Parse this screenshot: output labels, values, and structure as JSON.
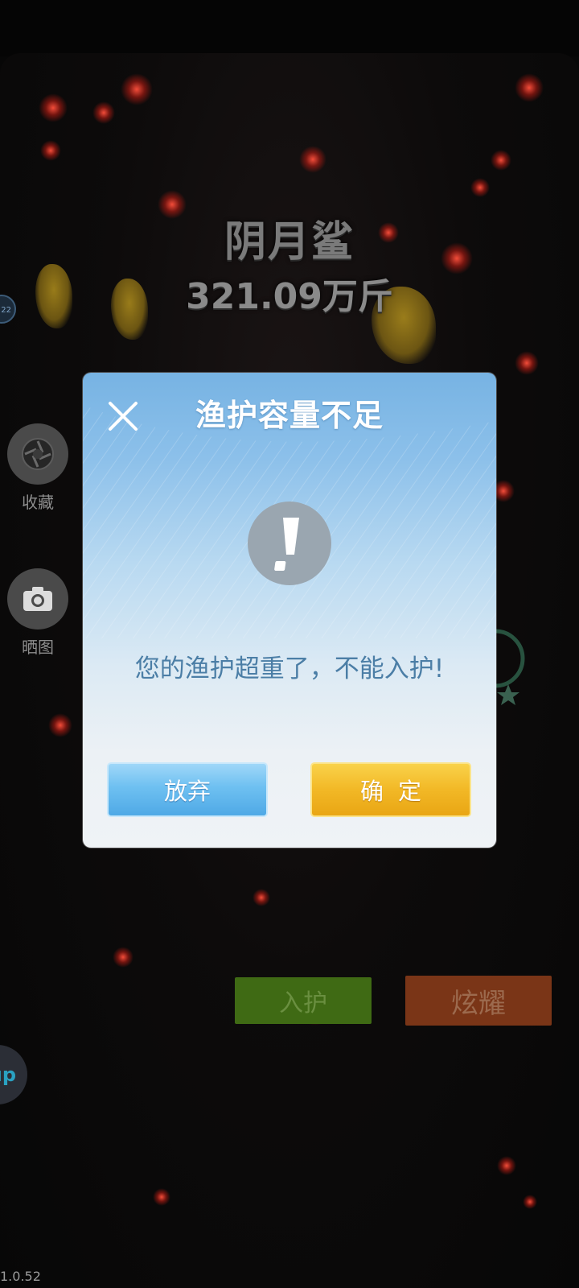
{
  "background": {
    "fish_name": "阴月鲨",
    "fish_weight": "321.09万斤",
    "side_badge_text": "22",
    "side_buttons": [
      {
        "label": "收藏",
        "icon": "aperture-icon"
      },
      {
        "label": "晒图",
        "icon": "camera-icon"
      }
    ],
    "up_badge_text": "up",
    "action_buttons": {
      "put_in_label": "入护",
      "show_off_label": "炫耀"
    },
    "version": "1.0.52"
  },
  "dialog": {
    "title": "渔护容量不足",
    "close_icon": "close-icon",
    "warning_icon": "exclamation-icon",
    "message": "您的渔护超重了，不能入护!",
    "cancel_label": "放弃",
    "confirm_label": "确定"
  },
  "colors": {
    "dialog_top": "#77b3e3",
    "dialog_bottom": "#eff3f6",
    "cancel_button": "#6ec0f1",
    "confirm_button": "#f2b826",
    "message_text": "#4b7ea6"
  }
}
